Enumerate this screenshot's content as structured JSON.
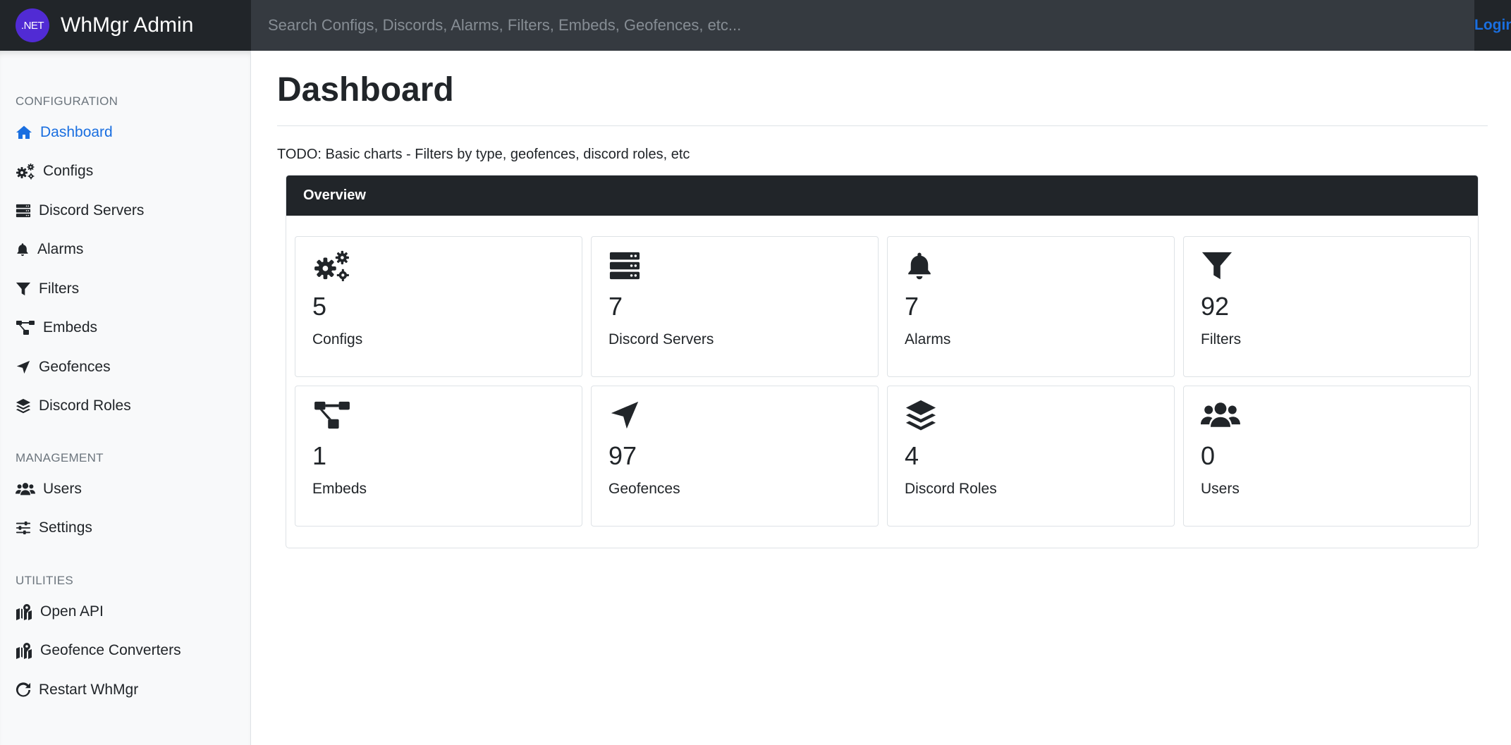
{
  "brand": {
    "logo_text": ".NET",
    "title": "WhMgr Admin"
  },
  "search": {
    "placeholder": "Search Configs, Discords, Alarms, Filters, Embeds, Geofences, etc..."
  },
  "login_label": "Login",
  "sidebar": {
    "configuration_heading": "CONFIGURATION",
    "management_heading": "MANAGEMENT",
    "utilities_heading": "UTILITIES",
    "configuration_items": [
      {
        "label": "Dashboard",
        "icon": "home-icon",
        "active": true
      },
      {
        "label": "Configs",
        "icon": "gears-icon"
      },
      {
        "label": "Discord Servers",
        "icon": "server-icon"
      },
      {
        "label": "Alarms",
        "icon": "bell-icon"
      },
      {
        "label": "Filters",
        "icon": "filter-icon"
      },
      {
        "label": "Embeds",
        "icon": "sitemap-icon"
      },
      {
        "label": "Geofences",
        "icon": "location-arrow-icon"
      },
      {
        "label": "Discord Roles",
        "icon": "layer-group-icon"
      }
    ],
    "management_items": [
      {
        "label": "Users",
        "icon": "users-icon"
      },
      {
        "label": "Settings",
        "icon": "sliders-icon"
      }
    ],
    "utilities_items": [
      {
        "label": "Open API",
        "icon": "map-marked-icon"
      },
      {
        "label": "Geofence Converters",
        "icon": "map-marked-icon"
      },
      {
        "label": "Restart WhMgr",
        "icon": "redo-icon"
      }
    ]
  },
  "main": {
    "title": "Dashboard",
    "todo": "TODO: Basic charts - Filters by type, geofences, discord roles, etc",
    "overview_title": "Overview",
    "cards": [
      {
        "count": "5",
        "label": "Configs",
        "icon": "gears-icon"
      },
      {
        "count": "7",
        "label": "Discord Servers",
        "icon": "server-icon"
      },
      {
        "count": "7",
        "label": "Alarms",
        "icon": "bell-icon"
      },
      {
        "count": "92",
        "label": "Filters",
        "icon": "filter-icon"
      },
      {
        "count": "1",
        "label": "Embeds",
        "icon": "sitemap-icon"
      },
      {
        "count": "97",
        "label": "Geofences",
        "icon": "location-arrow-icon"
      },
      {
        "count": "4",
        "label": "Discord Roles",
        "icon": "layer-group-icon"
      },
      {
        "count": "0",
        "label": "Users",
        "icon": "users-icon"
      }
    ]
  },
  "colors": {
    "navbar": "#212529",
    "search_bg": "#353a40",
    "accent": "#1a6fe0",
    "logo_bg": "#512bd4",
    "sidebar_bg": "#f8f9fa"
  }
}
